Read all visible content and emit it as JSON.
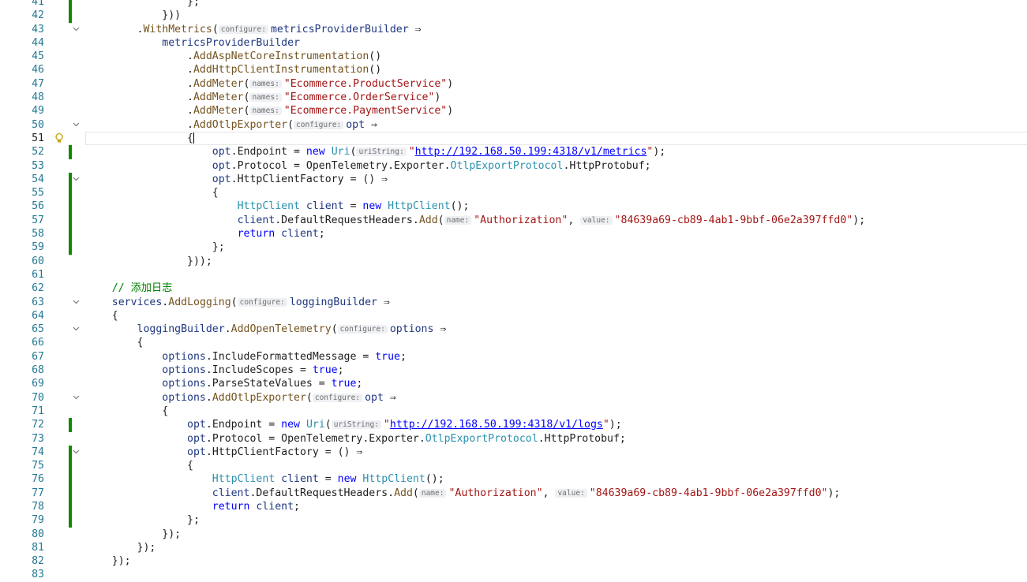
{
  "editor": {
    "language": "C#",
    "current_line": 51,
    "colors": {
      "keyword": "#0000ff",
      "method": "#74531f",
      "variable": "#1f377f",
      "type": "#2b91af",
      "string": "#a31515",
      "comment": "#008000",
      "line_number": "#237893",
      "modified_bar": "#108a00"
    },
    "lines": [
      {
        "n": 41,
        "mod": true,
        "tokens": [
          [
            "p",
            "                };"
          ]
        ]
      },
      {
        "n": 42,
        "mod": true,
        "tokens": [
          [
            "p",
            "            }))"
          ]
        ]
      },
      {
        "n": 43,
        "fold": true,
        "tokens": [
          [
            "p",
            "        ."
          ],
          [
            "mt",
            "WithMetrics"
          ],
          [
            "p",
            "("
          ],
          [
            "h",
            "configure:"
          ],
          [
            "vr",
            "metricsProviderBuilder"
          ],
          [
            "p",
            " ⇒"
          ]
        ]
      },
      {
        "n": 44,
        "tokens": [
          [
            "p",
            "            "
          ],
          [
            "vr",
            "metricsProviderBuilder"
          ]
        ]
      },
      {
        "n": 45,
        "tokens": [
          [
            "p",
            "                ."
          ],
          [
            "mt",
            "AddAspNetCoreInstrumentation"
          ],
          [
            "p",
            "()"
          ]
        ]
      },
      {
        "n": 46,
        "tokens": [
          [
            "p",
            "                ."
          ],
          [
            "mt",
            "AddHttpClientInstrumentation"
          ],
          [
            "p",
            "()"
          ]
        ]
      },
      {
        "n": 47,
        "tokens": [
          [
            "p",
            "                ."
          ],
          [
            "mt",
            "AddMeter"
          ],
          [
            "p",
            "("
          ],
          [
            "h",
            "names:"
          ],
          [
            "st",
            "\"Ecommerce.ProductService\""
          ],
          [
            "p",
            ")"
          ]
        ]
      },
      {
        "n": 48,
        "tokens": [
          [
            "p",
            "                ."
          ],
          [
            "mt",
            "AddMeter"
          ],
          [
            "p",
            "("
          ],
          [
            "h",
            "names:"
          ],
          [
            "st",
            "\"Ecommerce.OrderService\""
          ],
          [
            "p",
            ")"
          ]
        ]
      },
      {
        "n": 49,
        "tokens": [
          [
            "p",
            "                ."
          ],
          [
            "mt",
            "AddMeter"
          ],
          [
            "p",
            "("
          ],
          [
            "h",
            "names:"
          ],
          [
            "st",
            "\"Ecommerce.PaymentService\""
          ],
          [
            "p",
            ")"
          ]
        ]
      },
      {
        "n": 50,
        "fold": true,
        "tokens": [
          [
            "p",
            "                ."
          ],
          [
            "mt",
            "AddOtlpExporter"
          ],
          [
            "p",
            "("
          ],
          [
            "h",
            "configure:"
          ],
          [
            "vr",
            "opt"
          ],
          [
            "p",
            " ⇒"
          ]
        ]
      },
      {
        "n": 51,
        "current": true,
        "bulb": true,
        "tokens": [
          [
            "p",
            "                {"
          ],
          [
            "caret",
            ""
          ]
        ]
      },
      {
        "n": 52,
        "mod": true,
        "tokens": [
          [
            "p",
            "                    "
          ],
          [
            "vr",
            "opt"
          ],
          [
            "p",
            "."
          ],
          [
            "p",
            "Endpoint = "
          ],
          [
            "kw",
            "new"
          ],
          [
            "p",
            " "
          ],
          [
            "tp",
            "Uri"
          ],
          [
            "p",
            "("
          ],
          [
            "h",
            "uriString:"
          ],
          [
            "st",
            "\""
          ],
          [
            "url",
            "http://192.168.50.199:4318/v1/metrics"
          ],
          [
            "st",
            "\""
          ],
          [
            "p",
            ");"
          ]
        ]
      },
      {
        "n": 53,
        "tokens": [
          [
            "p",
            "                    "
          ],
          [
            "vr",
            "opt"
          ],
          [
            "p",
            ".Protocol = OpenTelemetry.Exporter."
          ],
          [
            "tp",
            "OtlpExportProtocol"
          ],
          [
            "p",
            ".HttpProtobuf;"
          ]
        ]
      },
      {
        "n": 54,
        "mod": true,
        "fold": true,
        "tokens": [
          [
            "p",
            "                    "
          ],
          [
            "vr",
            "opt"
          ],
          [
            "p",
            ".HttpClientFactory = () ⇒"
          ]
        ]
      },
      {
        "n": 55,
        "mod": true,
        "tokens": [
          [
            "p",
            "                    {"
          ]
        ]
      },
      {
        "n": 56,
        "mod": true,
        "tokens": [
          [
            "p",
            "                        "
          ],
          [
            "tp",
            "HttpClient"
          ],
          [
            "p",
            " "
          ],
          [
            "vr",
            "client"
          ],
          [
            "p",
            " = "
          ],
          [
            "kw",
            "new"
          ],
          [
            "p",
            " "
          ],
          [
            "tp",
            "HttpClient"
          ],
          [
            "p",
            "();"
          ]
        ]
      },
      {
        "n": 57,
        "mod": true,
        "tokens": [
          [
            "p",
            "                        "
          ],
          [
            "vr",
            "client"
          ],
          [
            "p",
            ".DefaultRequestHeaders."
          ],
          [
            "mt",
            "Add"
          ],
          [
            "p",
            "("
          ],
          [
            "h",
            "name:"
          ],
          [
            "st",
            "\"Authorization\""
          ],
          [
            "p",
            ", "
          ],
          [
            "h",
            "value:"
          ],
          [
            "st",
            "\"84639a69-cb89-4ab1-9bbf-06e2a397ffd0\""
          ],
          [
            "p",
            ");"
          ]
        ]
      },
      {
        "n": 58,
        "mod": true,
        "tokens": [
          [
            "p",
            "                        "
          ],
          [
            "kw",
            "return"
          ],
          [
            "p",
            " "
          ],
          [
            "vr",
            "client"
          ],
          [
            "p",
            ";"
          ]
        ]
      },
      {
        "n": 59,
        "mod": true,
        "tokens": [
          [
            "p",
            "                    };"
          ]
        ]
      },
      {
        "n": 60,
        "tokens": [
          [
            "p",
            "                }));"
          ]
        ]
      },
      {
        "n": 61,
        "tokens": []
      },
      {
        "n": 62,
        "tokens": [
          [
            "p",
            "    "
          ],
          [
            "cm",
            "// 添加日志"
          ]
        ]
      },
      {
        "n": 63,
        "fold": true,
        "tokens": [
          [
            "p",
            "    "
          ],
          [
            "vr",
            "services"
          ],
          [
            "p",
            "."
          ],
          [
            "mt",
            "AddLogging"
          ],
          [
            "p",
            "("
          ],
          [
            "h",
            "configure:"
          ],
          [
            "vr",
            "loggingBuilder"
          ],
          [
            "p",
            " ⇒"
          ]
        ]
      },
      {
        "n": 64,
        "tokens": [
          [
            "p",
            "    {"
          ]
        ]
      },
      {
        "n": 65,
        "fold": true,
        "tokens": [
          [
            "p",
            "        "
          ],
          [
            "vr",
            "loggingBuilder"
          ],
          [
            "p",
            "."
          ],
          [
            "mt",
            "AddOpenTelemetry"
          ],
          [
            "p",
            "("
          ],
          [
            "h",
            "configure:"
          ],
          [
            "vr",
            "options"
          ],
          [
            "p",
            " ⇒"
          ]
        ]
      },
      {
        "n": 66,
        "tokens": [
          [
            "p",
            "        {"
          ]
        ]
      },
      {
        "n": 67,
        "tokens": [
          [
            "p",
            "            "
          ],
          [
            "vr",
            "options"
          ],
          [
            "p",
            ".IncludeFormattedMessage = "
          ],
          [
            "kw",
            "true"
          ],
          [
            "p",
            ";"
          ]
        ]
      },
      {
        "n": 68,
        "tokens": [
          [
            "p",
            "            "
          ],
          [
            "vr",
            "options"
          ],
          [
            "p",
            ".IncludeScopes = "
          ],
          [
            "kw",
            "true"
          ],
          [
            "p",
            ";"
          ]
        ]
      },
      {
        "n": 69,
        "tokens": [
          [
            "p",
            "            "
          ],
          [
            "vr",
            "options"
          ],
          [
            "p",
            ".ParseStateValues = "
          ],
          [
            "kw",
            "true"
          ],
          [
            "p",
            ";"
          ]
        ]
      },
      {
        "n": 70,
        "fold": true,
        "tokens": [
          [
            "p",
            "            "
          ],
          [
            "vr",
            "options"
          ],
          [
            "p",
            "."
          ],
          [
            "mt",
            "AddOtlpExporter"
          ],
          [
            "p",
            "("
          ],
          [
            "h",
            "configure:"
          ],
          [
            "vr",
            "opt"
          ],
          [
            "p",
            " ⇒"
          ]
        ]
      },
      {
        "n": 71,
        "tokens": [
          [
            "p",
            "            {"
          ]
        ]
      },
      {
        "n": 72,
        "mod": true,
        "tokens": [
          [
            "p",
            "                "
          ],
          [
            "vr",
            "opt"
          ],
          [
            "p",
            ".Endpoint = "
          ],
          [
            "kw",
            "new"
          ],
          [
            "p",
            " "
          ],
          [
            "tp",
            "Uri"
          ],
          [
            "p",
            "("
          ],
          [
            "h",
            "uriString:"
          ],
          [
            "st",
            "\""
          ],
          [
            "url",
            "http://192.168.50.199:4318/v1/logs"
          ],
          [
            "st",
            "\""
          ],
          [
            "p",
            ");"
          ]
        ]
      },
      {
        "n": 73,
        "tokens": [
          [
            "p",
            "                "
          ],
          [
            "vr",
            "opt"
          ],
          [
            "p",
            ".Protocol = OpenTelemetry.Exporter."
          ],
          [
            "tp",
            "OtlpExportProtocol"
          ],
          [
            "p",
            ".HttpProtobuf;"
          ]
        ]
      },
      {
        "n": 74,
        "mod": true,
        "fold": true,
        "tokens": [
          [
            "p",
            "                "
          ],
          [
            "vr",
            "opt"
          ],
          [
            "p",
            ".HttpClientFactory = () ⇒"
          ]
        ]
      },
      {
        "n": 75,
        "mod": true,
        "tokens": [
          [
            "p",
            "                {"
          ]
        ]
      },
      {
        "n": 76,
        "mod": true,
        "tokens": [
          [
            "p",
            "                    "
          ],
          [
            "tp",
            "HttpClient"
          ],
          [
            "p",
            " "
          ],
          [
            "vr",
            "client"
          ],
          [
            "p",
            " = "
          ],
          [
            "kw",
            "new"
          ],
          [
            "p",
            " "
          ],
          [
            "tp",
            "HttpClient"
          ],
          [
            "p",
            "();"
          ]
        ]
      },
      {
        "n": 77,
        "mod": true,
        "tokens": [
          [
            "p",
            "                    "
          ],
          [
            "vr",
            "client"
          ],
          [
            "p",
            ".DefaultRequestHeaders."
          ],
          [
            "mt",
            "Add"
          ],
          [
            "p",
            "("
          ],
          [
            "h",
            "name:"
          ],
          [
            "st",
            "\"Authorization\""
          ],
          [
            "p",
            ", "
          ],
          [
            "h",
            "value:"
          ],
          [
            "st",
            "\"84639a69-cb89-4ab1-9bbf-06e2a397ffd0\""
          ],
          [
            "p",
            ");"
          ]
        ]
      },
      {
        "n": 78,
        "mod": true,
        "tokens": [
          [
            "p",
            "                    "
          ],
          [
            "kw",
            "return"
          ],
          [
            "p",
            " "
          ],
          [
            "vr",
            "client"
          ],
          [
            "p",
            ";"
          ]
        ]
      },
      {
        "n": 79,
        "mod": true,
        "tokens": [
          [
            "p",
            "                };"
          ]
        ]
      },
      {
        "n": 80,
        "tokens": [
          [
            "p",
            "            });"
          ]
        ]
      },
      {
        "n": 81,
        "tokens": [
          [
            "p",
            "        });"
          ]
        ]
      },
      {
        "n": 82,
        "tokens": [
          [
            "p",
            "    });"
          ]
        ]
      },
      {
        "n": 83,
        "tokens": []
      }
    ]
  }
}
